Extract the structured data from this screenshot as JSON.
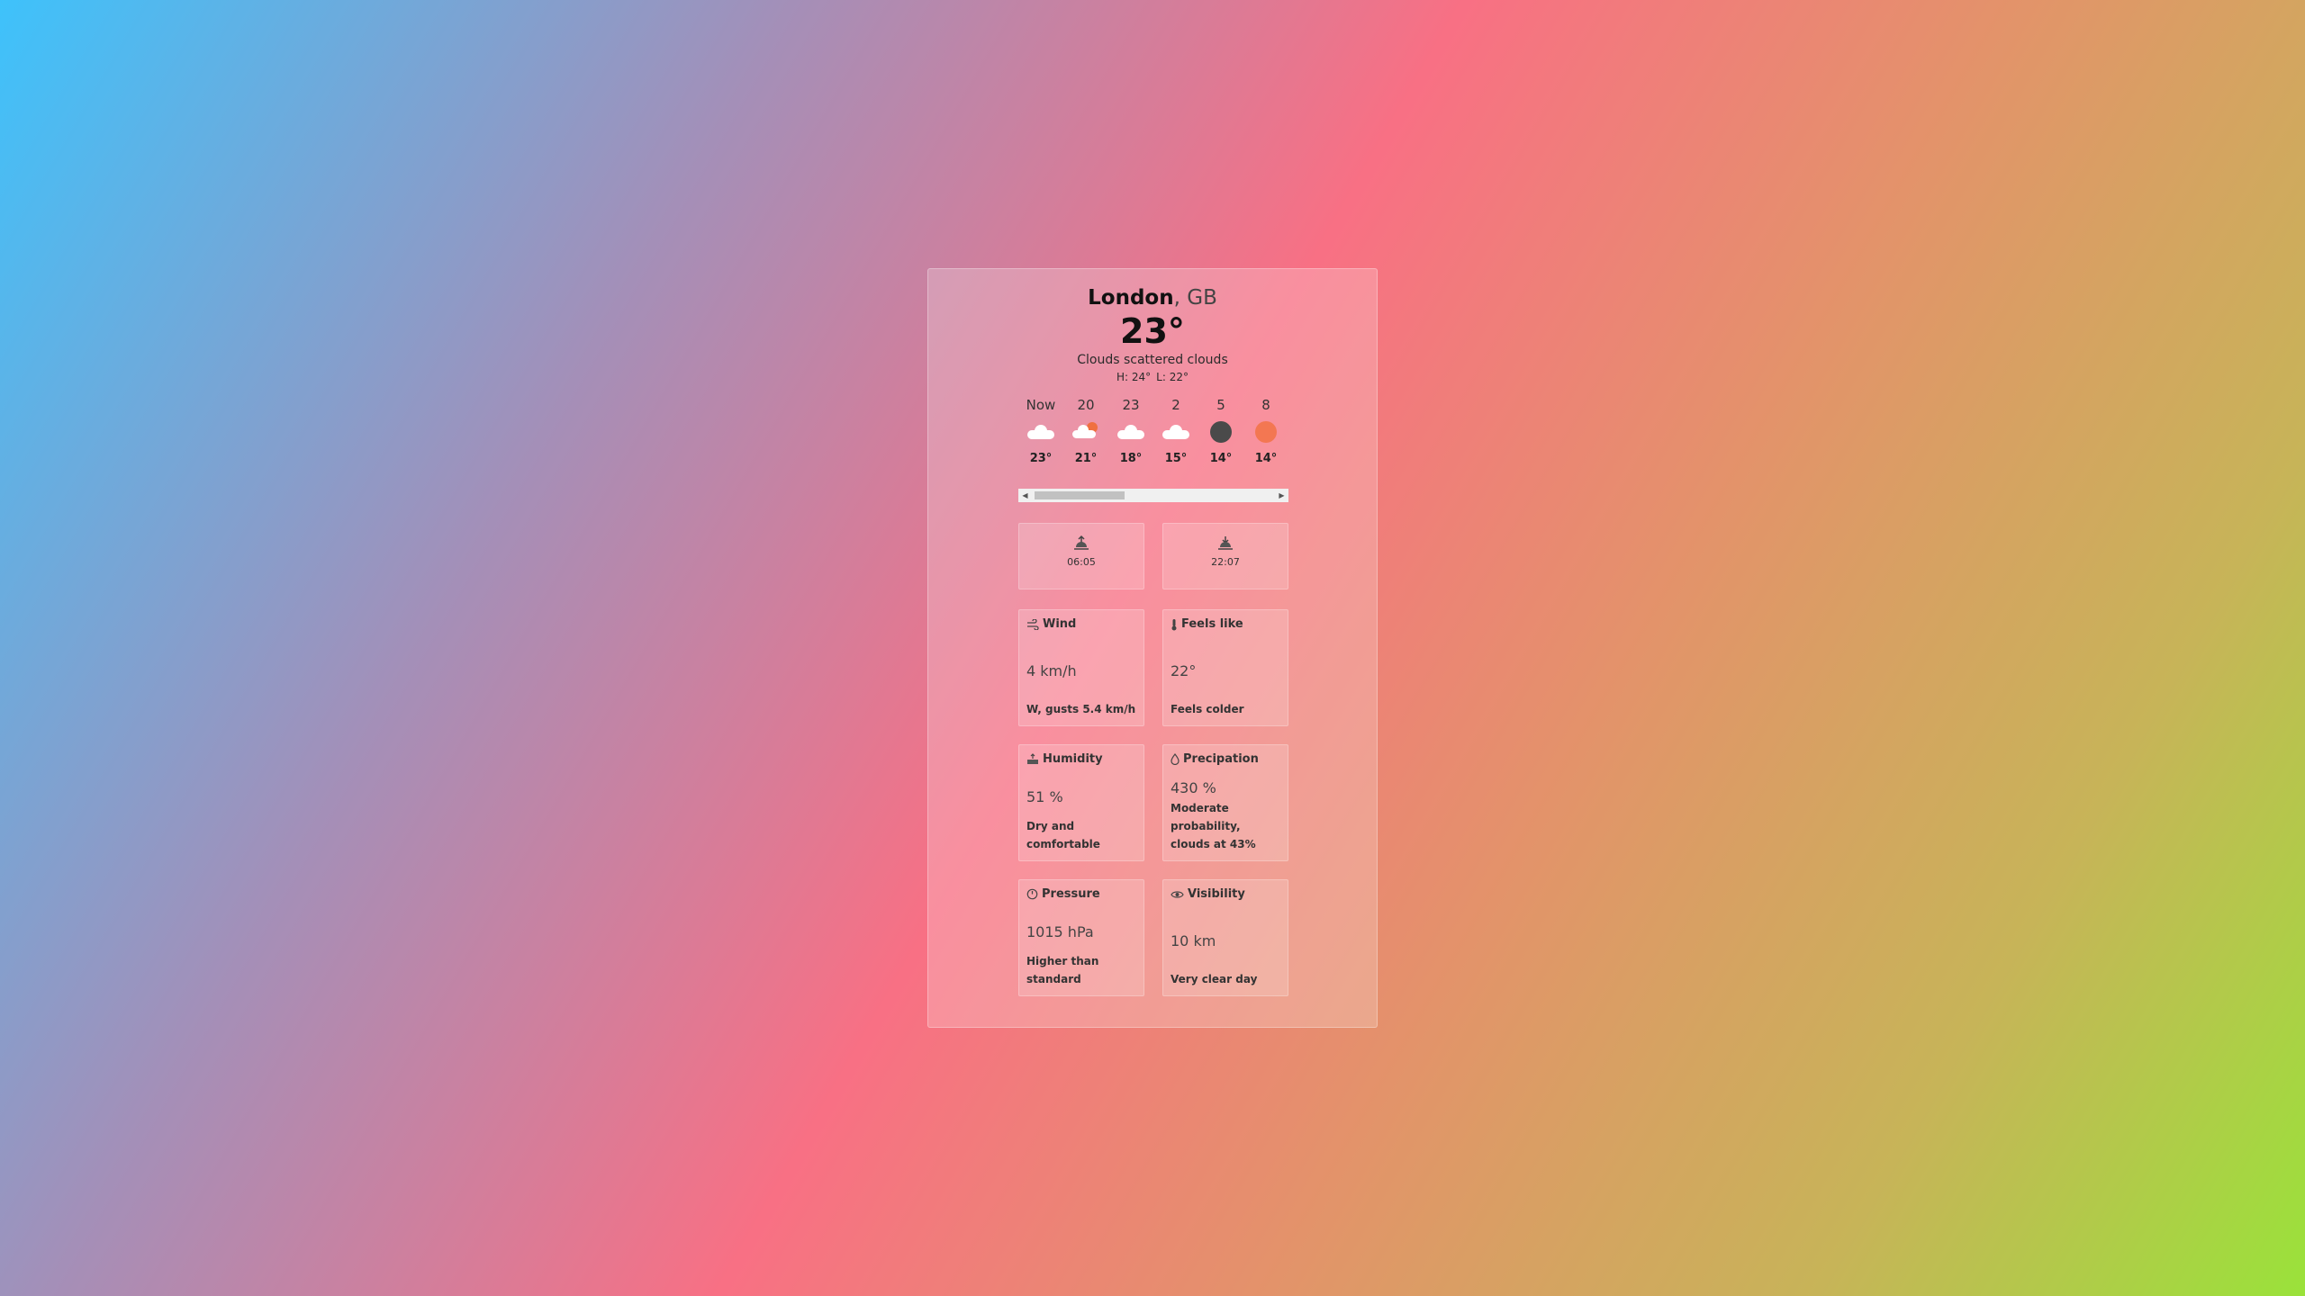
{
  "header": {
    "city": "London",
    "country": ", GB",
    "temp": "23°",
    "description": "Clouds scattered clouds",
    "high": "H: 24°",
    "low": "L: 22°"
  },
  "hourly": [
    {
      "time": "Now",
      "temp": "23°",
      "icon": "cloud-icon"
    },
    {
      "time": "20",
      "temp": "21°",
      "icon": "sun-behind-cloud-icon"
    },
    {
      "time": "23",
      "temp": "18°",
      "icon": "cloud-icon"
    },
    {
      "time": "2",
      "temp": "15°",
      "icon": "cloud-icon"
    },
    {
      "time": "5",
      "temp": "14°",
      "icon": "moon-icon"
    },
    {
      "time": "8",
      "temp": "14°",
      "icon": "sun-icon"
    }
  ],
  "sunrise": {
    "time": "06:05",
    "icon": "sunrise-icon"
  },
  "sunset": {
    "time": "22:07",
    "icon": "sunset-icon"
  },
  "tiles": {
    "wind": {
      "title": "Wind",
      "value": "4 km/h",
      "note": "W, gusts 5.4 km/h",
      "icon": "wind-icon"
    },
    "feels": {
      "title": "Feels like",
      "value": "22°",
      "note": "Feels colder",
      "icon": "thermometer-icon"
    },
    "humidity": {
      "title": "Humidity",
      "value": "51 %",
      "note": "Dry and comfortable",
      "icon": "humidity-icon"
    },
    "precip": {
      "title": "Precipation",
      "value": "430 %",
      "note": "Moderate probability, clouds at 43%",
      "icon": "droplet-icon"
    },
    "pressure": {
      "title": "Pressure",
      "value": "1015 hPa",
      "note": "Higher than standard",
      "icon": "gauge-icon"
    },
    "visibility": {
      "title": "Visibility",
      "value": "10 km",
      "note": "Very clear day",
      "icon": "eye-icon"
    }
  },
  "colors": {
    "sun": "#f37752",
    "moon": "#4a4a4a"
  }
}
